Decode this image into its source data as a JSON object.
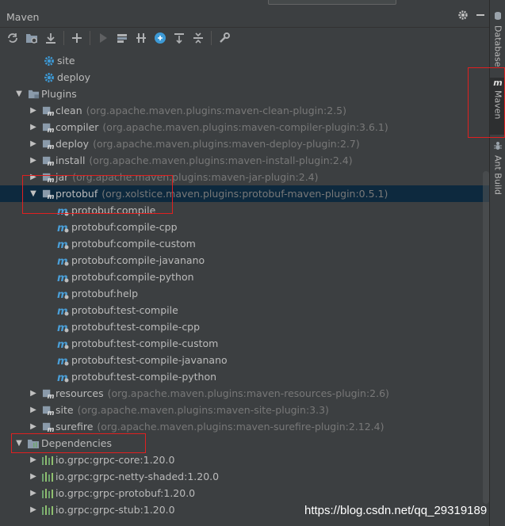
{
  "panel": {
    "title": "Maven"
  },
  "toolbar_icons": [
    "refresh-icon",
    "reimport-icon",
    "download-icon",
    "add-icon",
    "run-icon",
    "execute-goal-icon",
    "toggle-offline-icon",
    "skip-tests-icon",
    "show-dependencies-icon",
    "collapse-all-icon",
    "settings-wrench-icon"
  ],
  "tree": {
    "lifecycle_tail": [
      {
        "label": "site"
      },
      {
        "label": "deploy"
      }
    ],
    "plugins_label": "Plugins",
    "plugins_before": [
      {
        "label": "clean",
        "coord": "(org.apache.maven.plugins:maven-clean-plugin:2.5)"
      },
      {
        "label": "compiler",
        "coord": "(org.apache.maven.plugins:maven-compiler-plugin:3.6.1)"
      },
      {
        "label": "deploy",
        "coord": "(org.apache.maven.plugins:maven-deploy-plugin:2.7)"
      },
      {
        "label": "install",
        "coord": "(org.apache.maven.plugins:maven-install-plugin:2.4)"
      },
      {
        "label": "jar",
        "coord": "(org.apache.maven.plugins:maven-jar-plugin:2.4)"
      }
    ],
    "protobuf": {
      "label": "protobuf",
      "coord": "(org.xolstice.maven.plugins:protobuf-maven-plugin:0.5.1)"
    },
    "goals": [
      "protobuf:compile",
      "protobuf:compile-cpp",
      "protobuf:compile-custom",
      "protobuf:compile-javanano",
      "protobuf:compile-python",
      "protobuf:help",
      "protobuf:test-compile",
      "protobuf:test-compile-cpp",
      "protobuf:test-compile-custom",
      "protobuf:test-compile-javanano",
      "protobuf:test-compile-python"
    ],
    "plugins_after": [
      {
        "label": "resources",
        "coord": "(org.apache.maven.plugins:maven-resources-plugin:2.6)"
      },
      {
        "label": "site",
        "coord": "(org.apache.maven.plugins:maven-site-plugin:3.3)"
      },
      {
        "label": "surefire",
        "coord": "(org.apache.maven.plugins:maven-surefire-plugin:2.12.4)"
      }
    ],
    "dependencies_label": "Dependencies",
    "dependencies": [
      "io.grpc:grpc-core:1.20.0",
      "io.grpc:grpc-netty-shaded:1.20.0",
      "io.grpc:grpc-protobuf:1.20.0",
      "io.grpc:grpc-stub:1.20.0"
    ]
  },
  "side_tabs": [
    {
      "label": "Database",
      "icon": "database-icon",
      "active": false
    },
    {
      "label": "Maven",
      "icon": "maven-icon",
      "active": true
    },
    {
      "label": "Ant Build",
      "icon": "ant-icon",
      "active": false
    }
  ],
  "watermark": "https://blog.csdn.net/qq_29319189",
  "colors": {
    "selection": "#0d293e",
    "highlight_box": "#e02020",
    "goal_icon": "#4a9fd8",
    "gear": "#3d9ad6"
  }
}
